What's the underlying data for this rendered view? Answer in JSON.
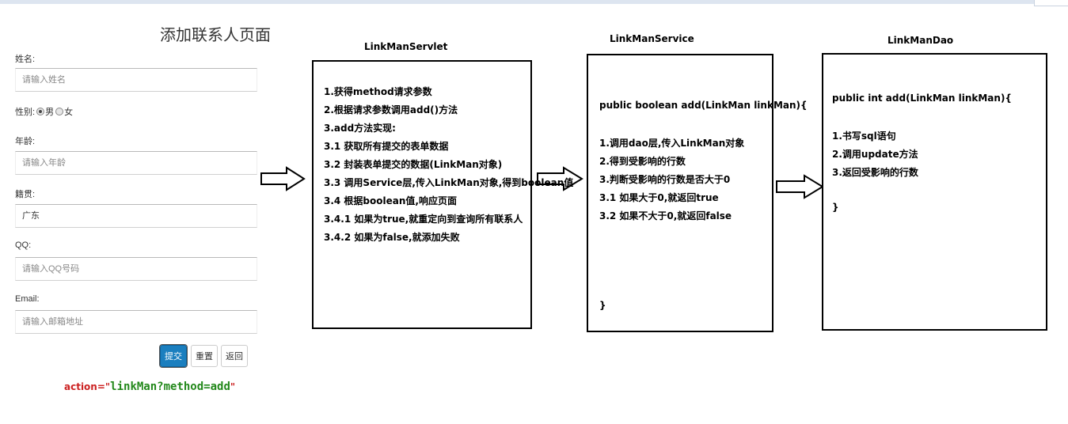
{
  "form": {
    "title": "添加联系人页面",
    "name_label": "姓名:",
    "name_placeholder": "请输入姓名",
    "gender_label": "性别:",
    "gender_male": "男",
    "gender_female": "女",
    "age_label": "年龄:",
    "age_placeholder": "请输入年龄",
    "native_label": "籍贯:",
    "native_value": "广东",
    "qq_label": "QQ:",
    "qq_placeholder": "请输入QQ号码",
    "email_label": "Email:",
    "email_placeholder": "请输入邮箱地址",
    "submit_label": "提交",
    "reset_label": "重置",
    "back_label": "返回",
    "action_attr": "action=\"",
    "action_value": "linkMan?method=add",
    "action_close": "\""
  },
  "servlet": {
    "title": "LinkManServlet",
    "lines": [
      "1.获得method请求参数",
      "2.根据请求参数调用add()方法",
      "3.add方法实现:",
      "3.1   获取所有提交的表单数据",
      "3.2 封装表单提交的数据(LinkMan对象)",
      "3.3 调用Service层,传入LinkMan对象,得到boolean值",
      "3.4 根据boolean值,响应页面",
      "3.4.1 如果为true,就重定向到查询所有联系人",
      "3.4.2 如果为false,就添加失败"
    ]
  },
  "service": {
    "title": "LinkManService",
    "signature": "public boolean add(LinkMan linkMan){",
    "lines": [
      "1.调用dao层,传入LinkMan对象",
      "2.得到受影响的行数",
      "3.判断受影响的行数是否大于0",
      "3.1 如果大于0,就返回true",
      "3.2 如果不大于0,就返回false"
    ],
    "close": "}"
  },
  "dao": {
    "title": "LinkManDao",
    "signature": "public int add(LinkMan linkMan){",
    "lines": [
      "1.书写sql语句",
      "2.调用update方法",
      "3.返回受影响的行数"
    ],
    "close": "}"
  }
}
